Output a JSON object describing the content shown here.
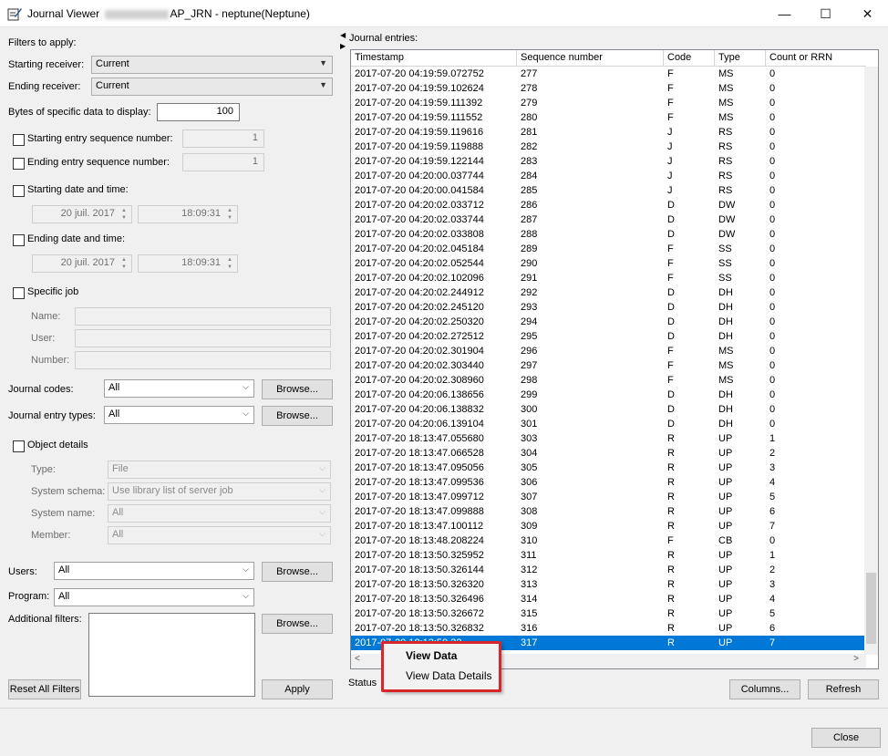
{
  "window": {
    "title_prefix": "Journal Viewer",
    "title_suffix": "AP_JRN - neptune(Neptune)",
    "minimize_glyph": "—",
    "maximize_glyph": "☐",
    "close_glyph": "✕"
  },
  "filters": {
    "heading": "Filters to apply:",
    "starting_receiver_label": "Starting receiver:",
    "starting_receiver_value": "Current",
    "ending_receiver_label": "Ending receiver:",
    "ending_receiver_value": "Current",
    "bytes_label": "Bytes of specific data to display:",
    "bytes_value": "100",
    "start_seq_label": "Starting entry sequence number:",
    "start_seq_value": "1",
    "end_seq_label": "Ending entry sequence number:",
    "end_seq_value": "1",
    "start_dt_label": "Starting date and time:",
    "start_date": "20 juil. 2017",
    "start_time": "18:09:31",
    "end_dt_label": "Ending date and time:",
    "end_date": "20 juil. 2017",
    "end_time": "18:09:31",
    "specific_job_label": "Specific job",
    "job_name_label": "Name:",
    "job_user_label": "User:",
    "job_number_label": "Number:",
    "journal_codes_label": "Journal codes:",
    "journal_codes_value": "All",
    "entry_types_label": "Journal entry types:",
    "entry_types_value": "All",
    "browse_label": "Browse...",
    "object_details_label": "Object details",
    "obj_type_label": "Type:",
    "obj_type_value": "File",
    "obj_schema_label": "System schema:",
    "obj_schema_value": "Use library list of server job",
    "obj_sysname_label": "System name:",
    "obj_sysname_value": "All",
    "obj_member_label": "Member:",
    "obj_member_value": "All",
    "users_label": "Users:",
    "users_value": "All",
    "program_label": "Program:",
    "program_value": "All",
    "additional_label": "Additional filters:",
    "reset_label": "Reset All Filters",
    "apply_label": "Apply"
  },
  "journal": {
    "heading": "Journal entries:",
    "columns": [
      "Timestamp",
      "Sequence number",
      "Code",
      "Type",
      "Count or RRN"
    ],
    "rows": [
      [
        "2017-07-20 04:19:59.072752",
        "277",
        "F",
        "MS",
        "0"
      ],
      [
        "2017-07-20 04:19:59.102624",
        "278",
        "F",
        "MS",
        "0"
      ],
      [
        "2017-07-20 04:19:59.111392",
        "279",
        "F",
        "MS",
        "0"
      ],
      [
        "2017-07-20 04:19:59.111552",
        "280",
        "F",
        "MS",
        "0"
      ],
      [
        "2017-07-20 04:19:59.119616",
        "281",
        "J",
        "RS",
        "0"
      ],
      [
        "2017-07-20 04:19:59.119888",
        "282",
        "J",
        "RS",
        "0"
      ],
      [
        "2017-07-20 04:19:59.122144",
        "283",
        "J",
        "RS",
        "0"
      ],
      [
        "2017-07-20 04:20:00.037744",
        "284",
        "J",
        "RS",
        "0"
      ],
      [
        "2017-07-20 04:20:00.041584",
        "285",
        "J",
        "RS",
        "0"
      ],
      [
        "2017-07-20 04:20:02.033712",
        "286",
        "D",
        "DW",
        "0"
      ],
      [
        "2017-07-20 04:20:02.033744",
        "287",
        "D",
        "DW",
        "0"
      ],
      [
        "2017-07-20 04:20:02.033808",
        "288",
        "D",
        "DW",
        "0"
      ],
      [
        "2017-07-20 04:20:02.045184",
        "289",
        "F",
        "SS",
        "0"
      ],
      [
        "2017-07-20 04:20:02.052544",
        "290",
        "F",
        "SS",
        "0"
      ],
      [
        "2017-07-20 04:20:02.102096",
        "291",
        "F",
        "SS",
        "0"
      ],
      [
        "2017-07-20 04:20:02.244912",
        "292",
        "D",
        "DH",
        "0"
      ],
      [
        "2017-07-20 04:20:02.245120",
        "293",
        "D",
        "DH",
        "0"
      ],
      [
        "2017-07-20 04:20:02.250320",
        "294",
        "D",
        "DH",
        "0"
      ],
      [
        "2017-07-20 04:20:02.272512",
        "295",
        "D",
        "DH",
        "0"
      ],
      [
        "2017-07-20 04:20:02.301904",
        "296",
        "F",
        "MS",
        "0"
      ],
      [
        "2017-07-20 04:20:02.303440",
        "297",
        "F",
        "MS",
        "0"
      ],
      [
        "2017-07-20 04:20:02.308960",
        "298",
        "F",
        "MS",
        "0"
      ],
      [
        "2017-07-20 04:20:06.138656",
        "299",
        "D",
        "DH",
        "0"
      ],
      [
        "2017-07-20 04:20:06.138832",
        "300",
        "D",
        "DH",
        "0"
      ],
      [
        "2017-07-20 04:20:06.139104",
        "301",
        "D",
        "DH",
        "0"
      ],
      [
        "2017-07-20 18:13:47.055680",
        "303",
        "R",
        "UP",
        "1"
      ],
      [
        "2017-07-20 18:13:47.066528",
        "304",
        "R",
        "UP",
        "2"
      ],
      [
        "2017-07-20 18:13:47.095056",
        "305",
        "R",
        "UP",
        "3"
      ],
      [
        "2017-07-20 18:13:47.099536",
        "306",
        "R",
        "UP",
        "4"
      ],
      [
        "2017-07-20 18:13:47.099712",
        "307",
        "R",
        "UP",
        "5"
      ],
      [
        "2017-07-20 18:13:47.099888",
        "308",
        "R",
        "UP",
        "6"
      ],
      [
        "2017-07-20 18:13:47.100112",
        "309",
        "R",
        "UP",
        "7"
      ],
      [
        "2017-07-20 18:13:48.208224",
        "310",
        "F",
        "CB",
        "0"
      ],
      [
        "2017-07-20 18:13:50.325952",
        "311",
        "R",
        "UP",
        "1"
      ],
      [
        "2017-07-20 18:13:50.326144",
        "312",
        "R",
        "UP",
        "2"
      ],
      [
        "2017-07-20 18:13:50.326320",
        "313",
        "R",
        "UP",
        "3"
      ],
      [
        "2017-07-20 18:13:50.326496",
        "314",
        "R",
        "UP",
        "4"
      ],
      [
        "2017-07-20 18:13:50.326672",
        "315",
        "R",
        "UP",
        "5"
      ],
      [
        "2017-07-20 18:13:50.326832",
        "316",
        "R",
        "UP",
        "6"
      ],
      [
        "2017-07-20 18:13:50.32",
        "317",
        "R",
        "UP",
        "7"
      ]
    ],
    "status_label": "Status",
    "columns_button": "Columns...",
    "refresh_button": "Refresh"
  },
  "context_menu": {
    "view_data": "View Data",
    "view_data_details": "View Data Details"
  },
  "footer": {
    "close_button": "Close"
  },
  "colors": {
    "selection": "#0078d7",
    "highlight_box": "#d9262b"
  }
}
